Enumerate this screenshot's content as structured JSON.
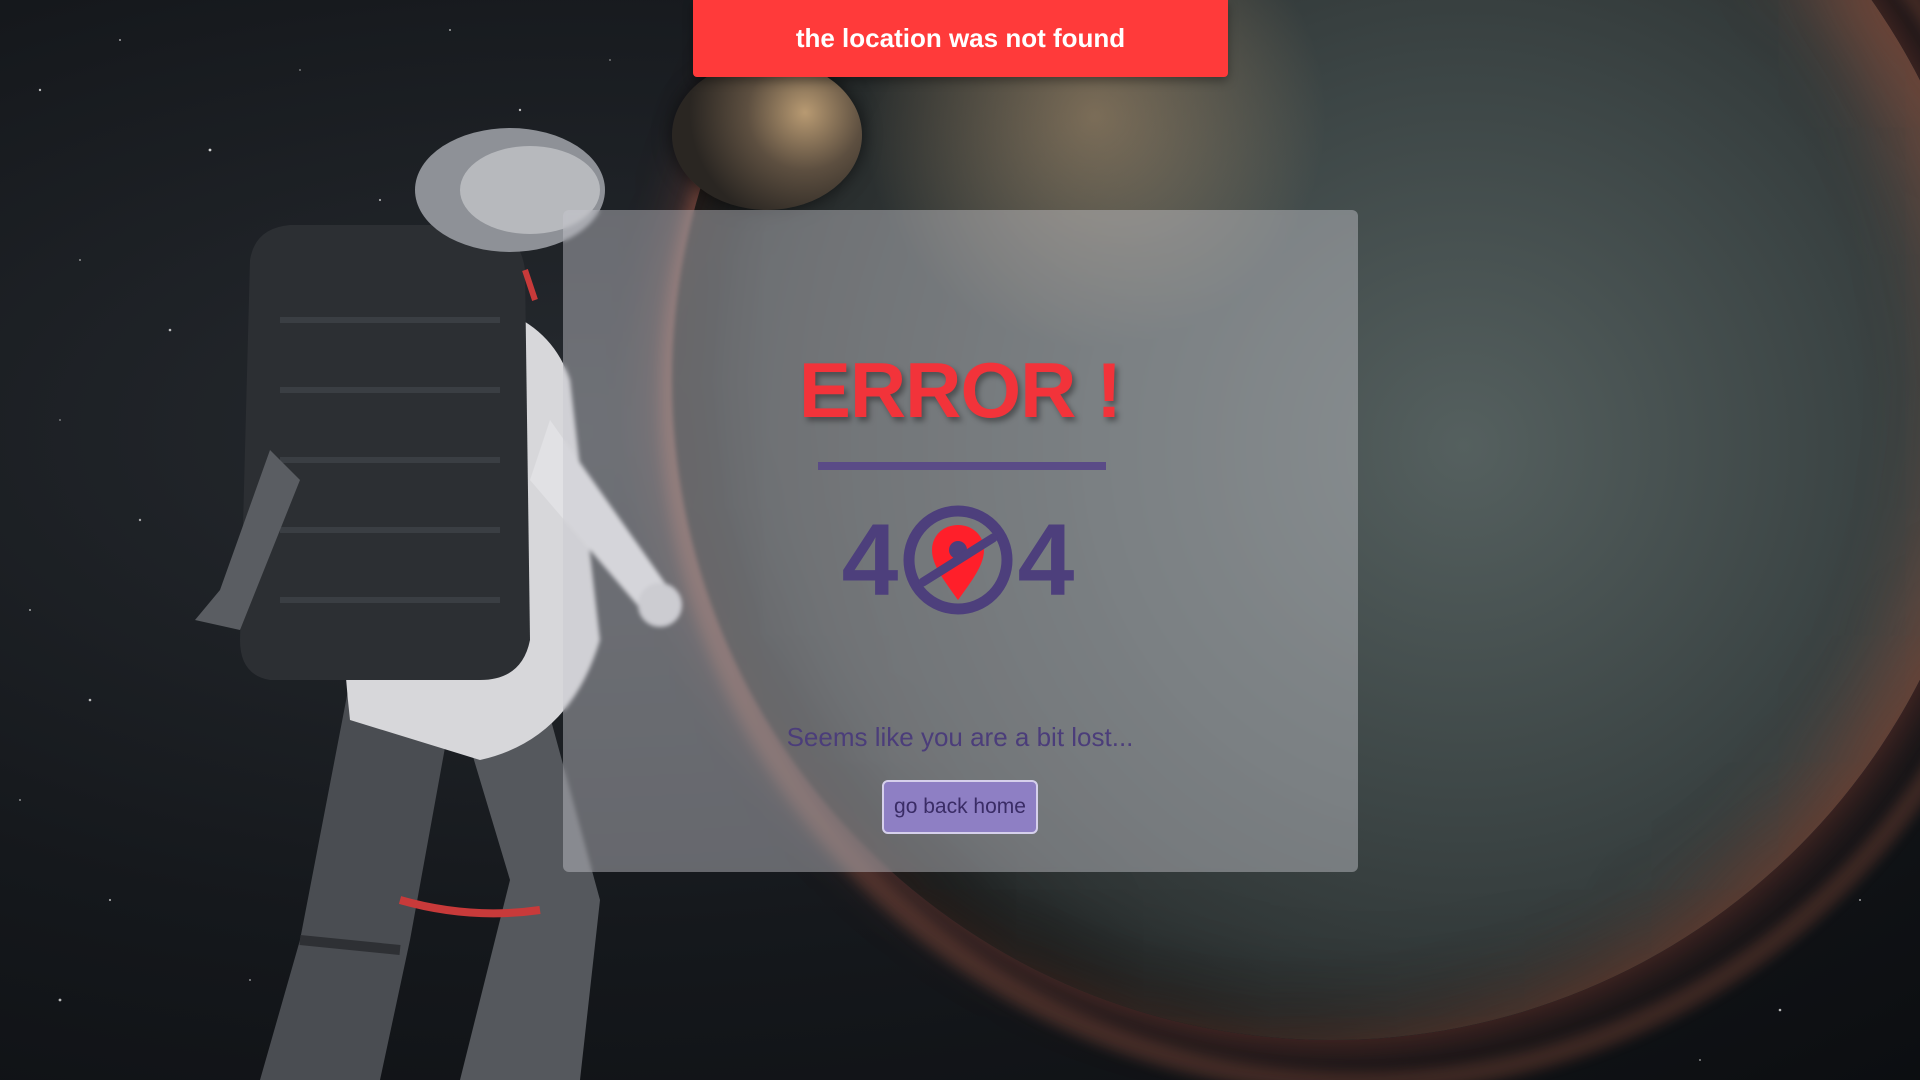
{
  "toast": {
    "message": "the location was not found",
    "color": "#ff3a3a"
  },
  "card": {
    "title": "ERROR !",
    "code_left": "4",
    "code_icon": "location-off-icon",
    "code_right": "4",
    "message": "Seems like you are a bit lost...",
    "button_label": "go back home"
  },
  "colors": {
    "title": "#f2333a",
    "accent": "#5a4b87",
    "button": "#8e7fc4"
  }
}
